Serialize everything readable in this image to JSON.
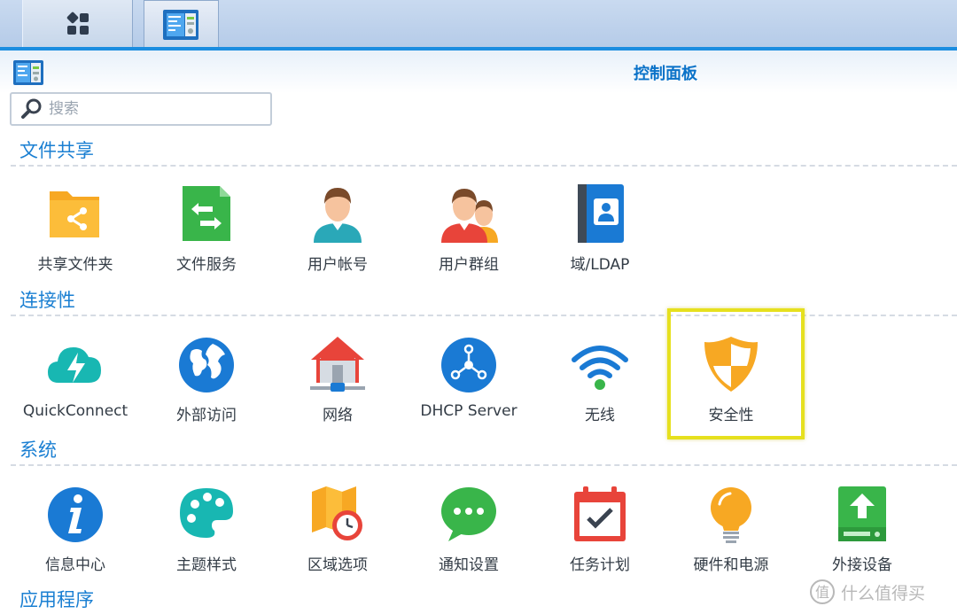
{
  "window": {
    "title": "控制面板"
  },
  "search": {
    "placeholder": "搜索"
  },
  "sections": [
    {
      "title": "文件共享",
      "items": [
        {
          "label": "共享文件夹",
          "icon": "shared-folder-icon"
        },
        {
          "label": "文件服务",
          "icon": "file-services-icon"
        },
        {
          "label": "用户帐号",
          "icon": "user-icon"
        },
        {
          "label": "用户群组",
          "icon": "group-icon"
        },
        {
          "label": "域/LDAP",
          "icon": "domain-ldap-icon"
        }
      ]
    },
    {
      "title": "连接性",
      "items": [
        {
          "label": "QuickConnect",
          "icon": "quickconnect-icon"
        },
        {
          "label": "外部访问",
          "icon": "external-access-icon"
        },
        {
          "label": "网络",
          "icon": "network-icon"
        },
        {
          "label": "DHCP Server",
          "icon": "dhcp-server-icon"
        },
        {
          "label": "无线",
          "icon": "wireless-icon"
        },
        {
          "label": "安全性",
          "icon": "security-icon"
        }
      ]
    },
    {
      "title": "系统",
      "items": [
        {
          "label": "信息中心",
          "icon": "info-center-icon"
        },
        {
          "label": "主题样式",
          "icon": "theme-icon"
        },
        {
          "label": "区域选项",
          "icon": "regional-options-icon"
        },
        {
          "label": "通知设置",
          "icon": "notification-icon"
        },
        {
          "label": "任务计划",
          "icon": "task-scheduler-icon"
        },
        {
          "label": "硬件和电源",
          "icon": "hardware-power-icon"
        },
        {
          "label": "外接设备",
          "icon": "external-devices-icon"
        }
      ]
    },
    {
      "title": "应用程序",
      "items": []
    }
  ],
  "watermark": {
    "text": "什么值得买"
  },
  "colors": {
    "accent": "#1b8de0",
    "section_title": "#1a7fd2",
    "highlight": "#e6e01e"
  }
}
